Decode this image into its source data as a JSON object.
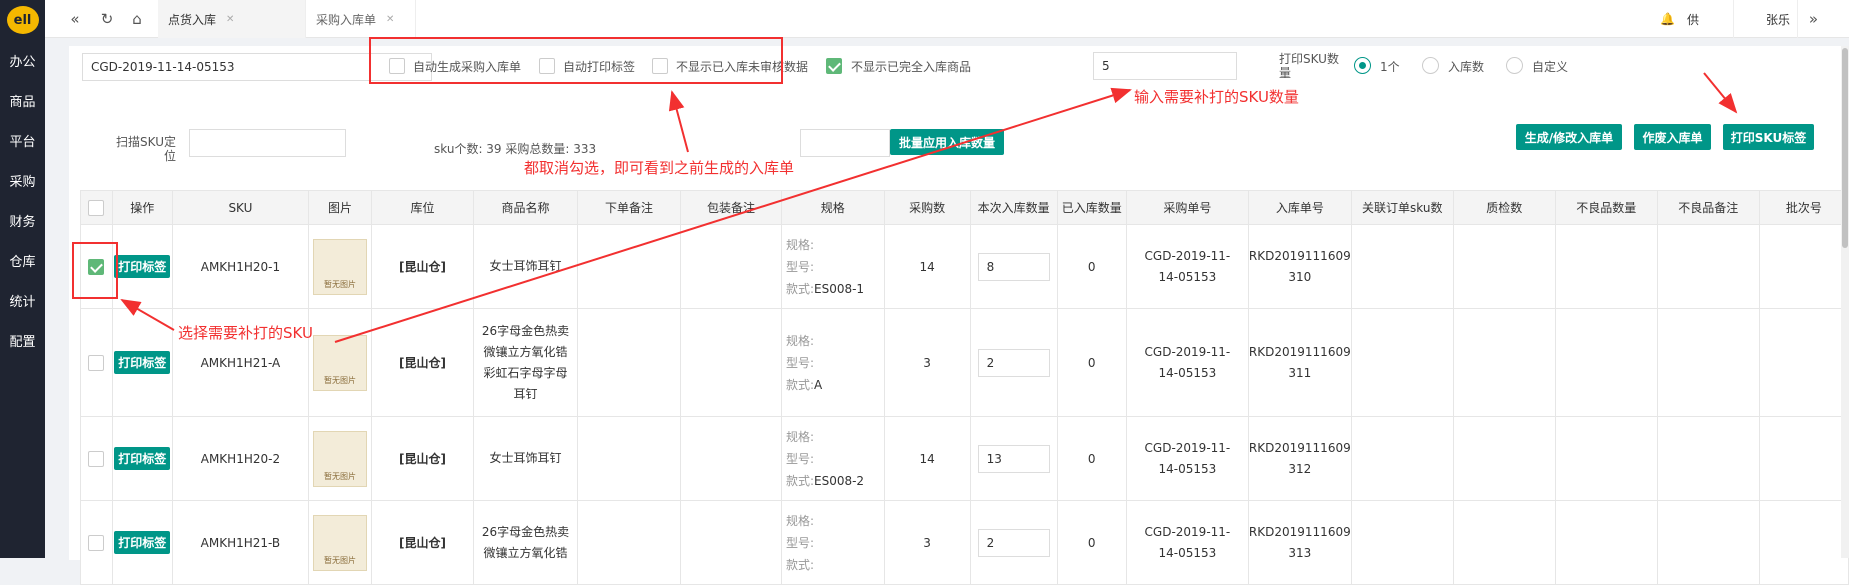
{
  "sidebar": {
    "logo": "ell",
    "items": [
      "办公",
      "商品",
      "平台",
      "采购",
      "财务",
      "仓库",
      "统计",
      "配置"
    ]
  },
  "topbar": {
    "tabs": [
      {
        "label": "点货入库",
        "active": true
      },
      {
        "label": "采购入库单",
        "active": false
      }
    ],
    "right": {
      "supplier": "供",
      "user": "张乐"
    }
  },
  "filters": {
    "order_no": "CGD-2019-11-14-05153",
    "checkboxes": [
      {
        "label": "自动生成采购入库单",
        "checked": false
      },
      {
        "label": "自动打印标签",
        "checked": false
      },
      {
        "label": "不显示已入库未审核数据",
        "checked": false
      },
      {
        "label": "不显示已完全入库商品",
        "checked": true
      }
    ],
    "print_count_value": "5",
    "print_sku_qty_label": "打印SKU数量",
    "radio_options": [
      {
        "label": "1个",
        "selected": true
      },
      {
        "label": "入库数",
        "selected": false
      },
      {
        "label": "自定义",
        "selected": false
      }
    ]
  },
  "toolbar": {
    "scan_label": "扫描SKU定位",
    "stats": "sku个数: 39 采购总数量: 333",
    "batch_apply": "批量应用入库数量",
    "generate": "生成/修改入库单",
    "void": "作废入库单",
    "print_labels": "打印SKU标签"
  },
  "annotations": {
    "input_hint": "输入需要补打的SKU数量",
    "uncheck_hint": "都取消勾选，即可看到之前生成的入库单",
    "select_hint": "选择需要补打的SKU"
  },
  "table": {
    "headers": [
      "操作",
      "SKU",
      "图片",
      "库位",
      "商品名称",
      "下单备注",
      "包装备注",
      "规格",
      "采购数",
      "本次入库数量",
      "已入库数量",
      "采购单号",
      "入库单号",
      "关联订单sku数",
      "质检数",
      "不良品数量",
      "不良品备注",
      "批次号"
    ],
    "print_label": "打印标签",
    "image_placeholder": "暂无图片",
    "spec_labels": {
      "spec": "规格:",
      "model": "型号:",
      "style": "款式:"
    },
    "rows": [
      {
        "checked": true,
        "sku": "AMKH1H20-1",
        "location": "[昆山仓]",
        "name": [
          "女士耳饰耳钉"
        ],
        "style": "ES008-1",
        "purchase_qty": "14",
        "this_qty": "8",
        "in_qty": "0",
        "po_no": [
          "CGD-2019-11-",
          "14-05153"
        ],
        "rkd_no": [
          "RKD2019111609",
          "310"
        ]
      },
      {
        "checked": false,
        "sku": "AMKH1H21-A",
        "location": "[昆山仓]",
        "name": [
          "26字母金色热卖",
          "微镶立方氧化锆",
          "彩虹石字母字母",
          "耳钉"
        ],
        "style": "A",
        "purchase_qty": "3",
        "this_qty": "2",
        "in_qty": "0",
        "po_no": [
          "CGD-2019-11-",
          "14-05153"
        ],
        "rkd_no": [
          "RKD2019111609",
          "311"
        ]
      },
      {
        "checked": false,
        "sku": "AMKH1H20-2",
        "location": "[昆山仓]",
        "name": [
          "女士耳饰耳钉"
        ],
        "style": "ES008-2",
        "purchase_qty": "14",
        "this_qty": "13",
        "in_qty": "0",
        "po_no": [
          "CGD-2019-11-",
          "14-05153"
        ],
        "rkd_no": [
          "RKD2019111609",
          "312"
        ]
      },
      {
        "checked": false,
        "sku": "AMKH1H21-B",
        "location": "[昆山仓]",
        "name": [
          "26字母金色热卖",
          "微镶立方氧化锆"
        ],
        "style": "",
        "purchase_qty": "3",
        "this_qty": "2",
        "in_qty": "0",
        "po_no": [
          "CGD-2019-11-",
          "14-05153"
        ],
        "rkd_no": [
          "RKD2019111609",
          "313"
        ]
      }
    ]
  },
  "colors": {
    "accent": "#009688",
    "annotation": "#f23030",
    "sidebar": "#1f2431",
    "checked": "#5fb878"
  }
}
